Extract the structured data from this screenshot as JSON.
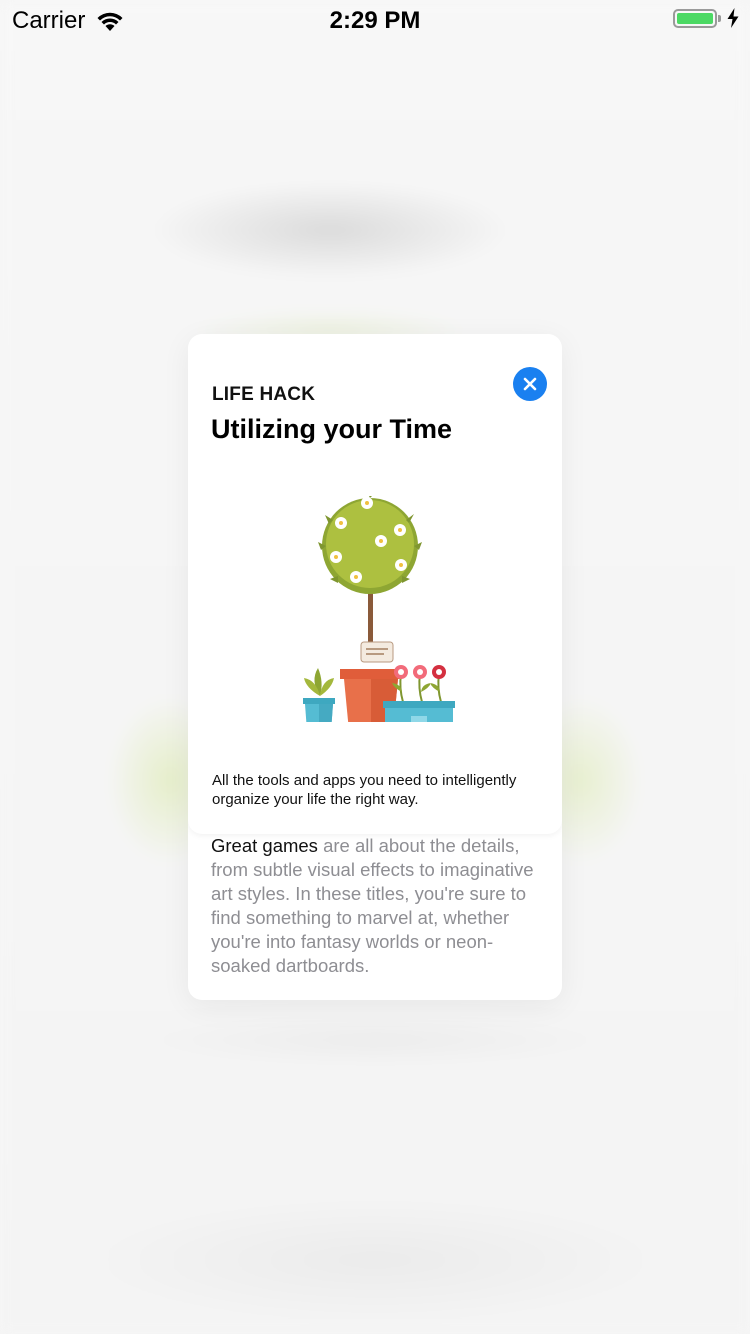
{
  "status_bar": {
    "carrier": "Carrier",
    "time": "2:29 PM",
    "battery_level": 1.0,
    "battery_color": "#4cd964",
    "icons": [
      "wifi-icon",
      "battery-icon",
      "charging-bolt-icon"
    ]
  },
  "card": {
    "eyebrow": "LIFE HACK",
    "title": "Utilizing your Time",
    "close_icon": "close-icon",
    "close_color": "#1a80f0",
    "illustration": "potted-plants-illustration",
    "description": "All the tools and apps you need to intelligently organize your life the right way.",
    "body_lead": "Great games",
    "body_rest": " are all about the details, from subtle visual effects to imaginative art styles. In these titles, you're sure to find something to marvel at, whether you're into fantasy worlds or neon-soaked dartboards."
  }
}
